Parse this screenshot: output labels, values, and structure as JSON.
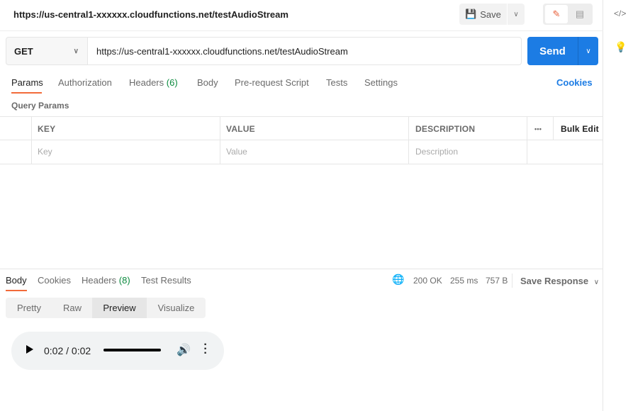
{
  "request": {
    "title": "https://us-central1-xxxxxx.cloudfunctions.net/testAudioStream",
    "save_label": "Save",
    "method": "GET",
    "url": "https://us-central1-xxxxxx.cloudfunctions.net/testAudioStream",
    "send_label": "Send"
  },
  "tabs": [
    {
      "label": "Params"
    },
    {
      "label": "Authorization"
    },
    {
      "label": "Headers",
      "count": "(6)"
    },
    {
      "label": "Body"
    },
    {
      "label": "Pre-request Script"
    },
    {
      "label": "Tests"
    },
    {
      "label": "Settings"
    }
  ],
  "cookies_label": "Cookies",
  "query_params": {
    "title": "Query Params",
    "columns": [
      "KEY",
      "VALUE",
      "DESCRIPTION"
    ],
    "more": "•••",
    "bulk_edit": "Bulk Edit",
    "placeholders": [
      "Key",
      "Value",
      "Description"
    ]
  },
  "response": {
    "tabs": [
      {
        "label": "Body"
      },
      {
        "label": "Cookies"
      },
      {
        "label": "Headers",
        "count": "(8)"
      },
      {
        "label": "Test Results"
      }
    ],
    "status": "200 OK",
    "time": "255 ms",
    "size": "757 B",
    "save_response": "Save Response",
    "formats": [
      "Pretty",
      "Raw",
      "Preview",
      "Visualize"
    ],
    "active_format": "Preview"
  },
  "player": {
    "time": "0:02 / 0:02",
    "progress": 1.0
  },
  "colors": {
    "accent": "#f26b3a",
    "primary": "#1c7ce4",
    "success": "#0b8a3e"
  }
}
